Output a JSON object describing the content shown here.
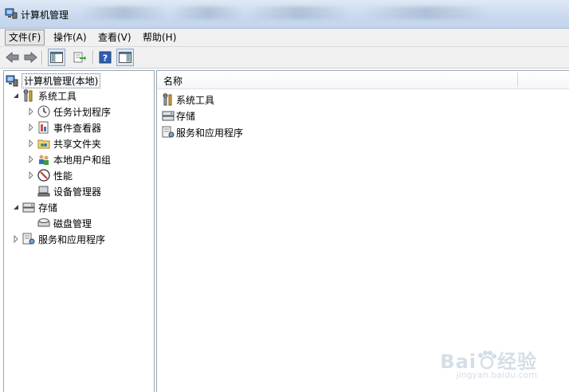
{
  "window": {
    "title": "计算机管理"
  },
  "menu": [
    {
      "label": "文件(F)",
      "active": true
    },
    {
      "label": "操作(A)"
    },
    {
      "label": "查看(V)"
    },
    {
      "label": "帮助(H)"
    }
  ],
  "toolbar": {
    "buttons": [
      "back-icon",
      "forward-icon",
      "show-tree-icon",
      "export-list-icon",
      "help-icon",
      "show-action-pane-icon"
    ]
  },
  "tree": {
    "root": "计算机管理(本地)",
    "system_tools": "系统工具",
    "task_scheduler": "任务计划程序",
    "event_viewer": "事件查看器",
    "shared_folders": "共享文件夹",
    "local_users": "本地用户和组",
    "performance": "性能",
    "device_manager": "设备管理器",
    "storage": "存储",
    "disk_management": "磁盘管理",
    "services_apps": "服务和应用程序"
  },
  "list": {
    "column_name": "名称",
    "items": [
      "系统工具",
      "存储",
      "服务和应用程序"
    ]
  },
  "watermark": {
    "main": "Bai",
    "main2": "经验",
    "sub": "jingyan.baidu.com"
  }
}
